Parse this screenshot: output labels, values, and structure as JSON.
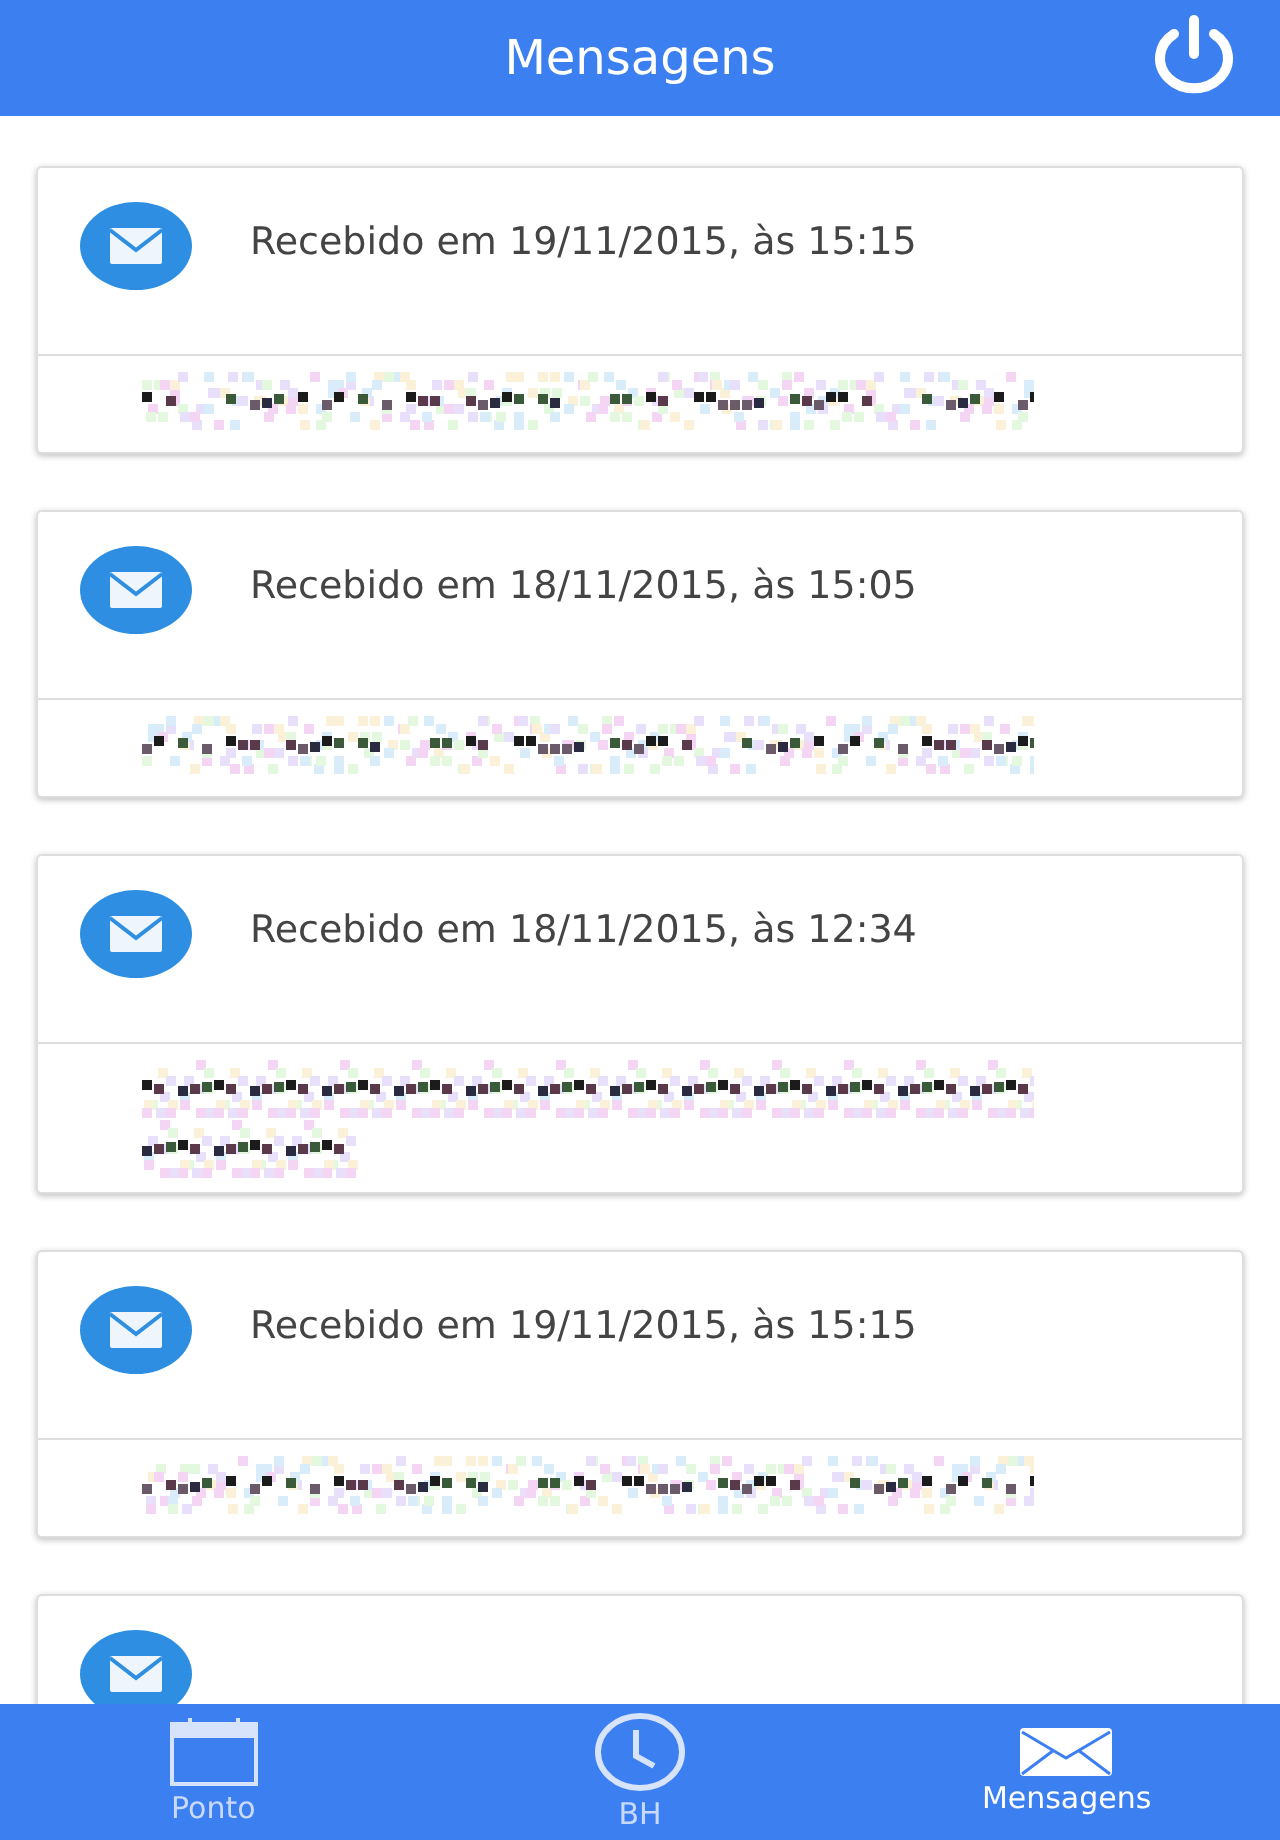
{
  "header": {
    "title": "Mensagens"
  },
  "messages": [
    {
      "received": "Recebido em 19/11/2015, às 15:15",
      "kind": "redacted_line"
    },
    {
      "received": "Recebido em 18/11/2015, às 15:05",
      "kind": "redacted_line"
    },
    {
      "received": "Recebido em 18/11/2015, às 12:34",
      "kind": "redacted_paragraph"
    },
    {
      "received": "Recebido em 19/11/2015, às 15:15",
      "kind": "redacted_line"
    },
    {
      "kind": "cut_off"
    }
  ],
  "tabs": [
    {
      "label": "Ponto",
      "selected": false
    },
    {
      "label": "BH",
      "selected": false
    },
    {
      "label": "Mensagens",
      "selected": true
    }
  ]
}
